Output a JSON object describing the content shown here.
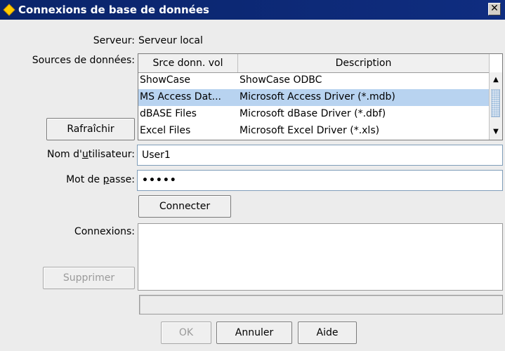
{
  "window": {
    "title": "Connexions de base de données",
    "close_glyph": "✕"
  },
  "server": {
    "label": "Serveur:",
    "value": "Serveur local"
  },
  "data_sources": {
    "label": "Sources de données:",
    "columns": [
      "Srce donn. vol",
      "Description"
    ],
    "rows": [
      {
        "name": "ShowCase",
        "description": "ShowCase ODBC"
      },
      {
        "name": "MS Access Dat...",
        "description": "Microsoft Access Driver (*.mdb)"
      },
      {
        "name": "dBASE Files",
        "description": "Microsoft dBase Driver (*.dbf)"
      },
      {
        "name": "Excel Files",
        "description": "Microsoft Excel Driver (*.xls)"
      }
    ],
    "selected_index": 1
  },
  "buttons": {
    "refresh": "Rafraîchir",
    "connect": "Connecter",
    "delete": "Supprimer",
    "ok": "OK",
    "cancel": "Annuler",
    "help": "Aide"
  },
  "username": {
    "label_pre": "Nom d'",
    "label_mnemonic": "u",
    "label_post": "tilisateur:",
    "value": "User1"
  },
  "password": {
    "label_pre": "Mot de ",
    "label_mnemonic": "p",
    "label_post": "asse:",
    "value": "•••••"
  },
  "connections": {
    "label": "Connexions:"
  },
  "colors": {
    "titlebar": "#0a246a",
    "selection": "#b8d3f0",
    "icon": "#ffcc00"
  }
}
